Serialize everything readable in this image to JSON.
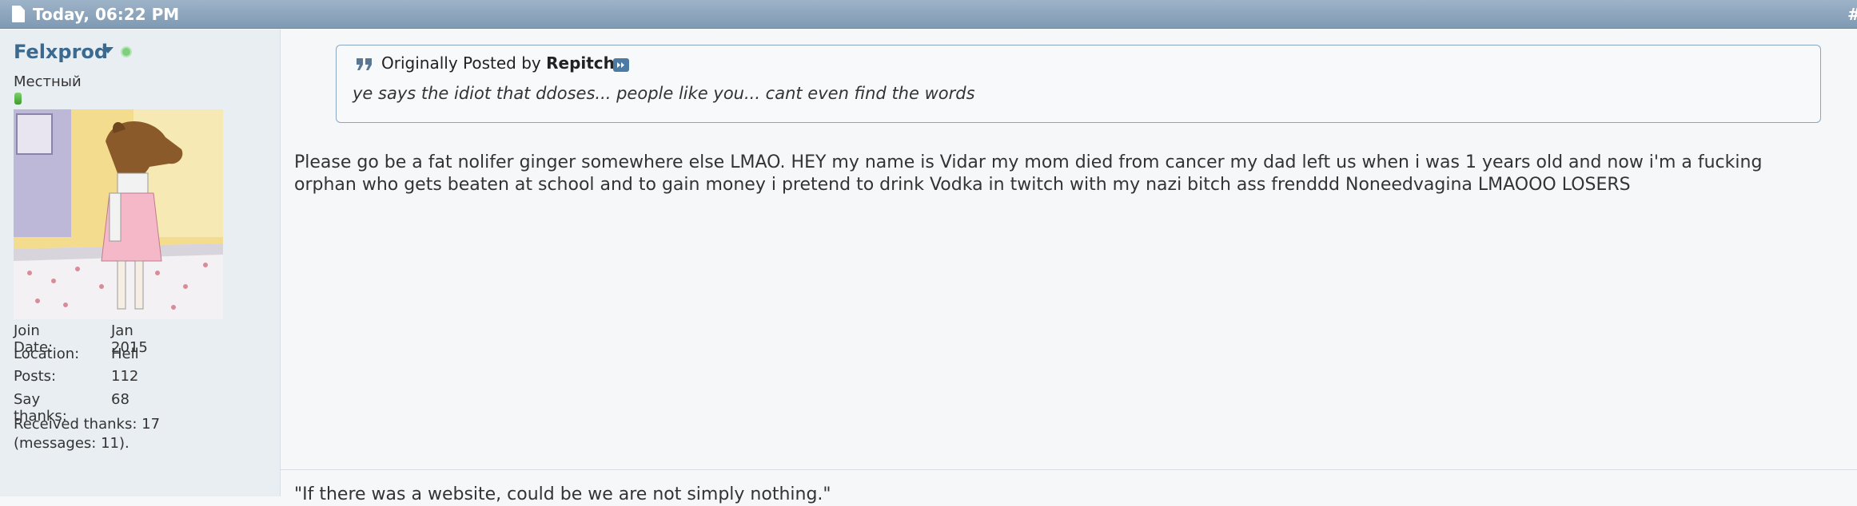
{
  "post": {
    "date": "Today, 06:22 PM",
    "number": "#"
  },
  "user": {
    "name": "Felxprod",
    "title": "Местный",
    "avatar_alt": "horse-head avatar",
    "stats": [
      {
        "label": "Join Date:",
        "value": "Jan 2015"
      },
      {
        "label": "Location:",
        "value": "Hell"
      },
      {
        "label": "Posts:",
        "value": "112"
      },
      {
        "label": "Say thanks:",
        "value": "68"
      }
    ],
    "received_thanks": "Received thanks: 17 (messages: 11)."
  },
  "quote": {
    "prefix": "Originally Posted by ",
    "author": "Repitchx",
    "text": "ye says the idiot that ddoses... people like you... cant even find the words"
  },
  "message": {
    "text": "Please go be a fat nolifer ginger somewhere else LMAO. HEY my name is Vidar my mom died from cancer my dad left us when i was 1 years old and now i'm a fucking orphan who gets beaten at school and to gain money i pretend to drink Vodka in twitch with my nazi bitch ass frenddd Noneedvagina LMAOOO LOSERS"
  },
  "signature": {
    "text": "\"If there was a website, could be we are not simply nothing.\""
  }
}
